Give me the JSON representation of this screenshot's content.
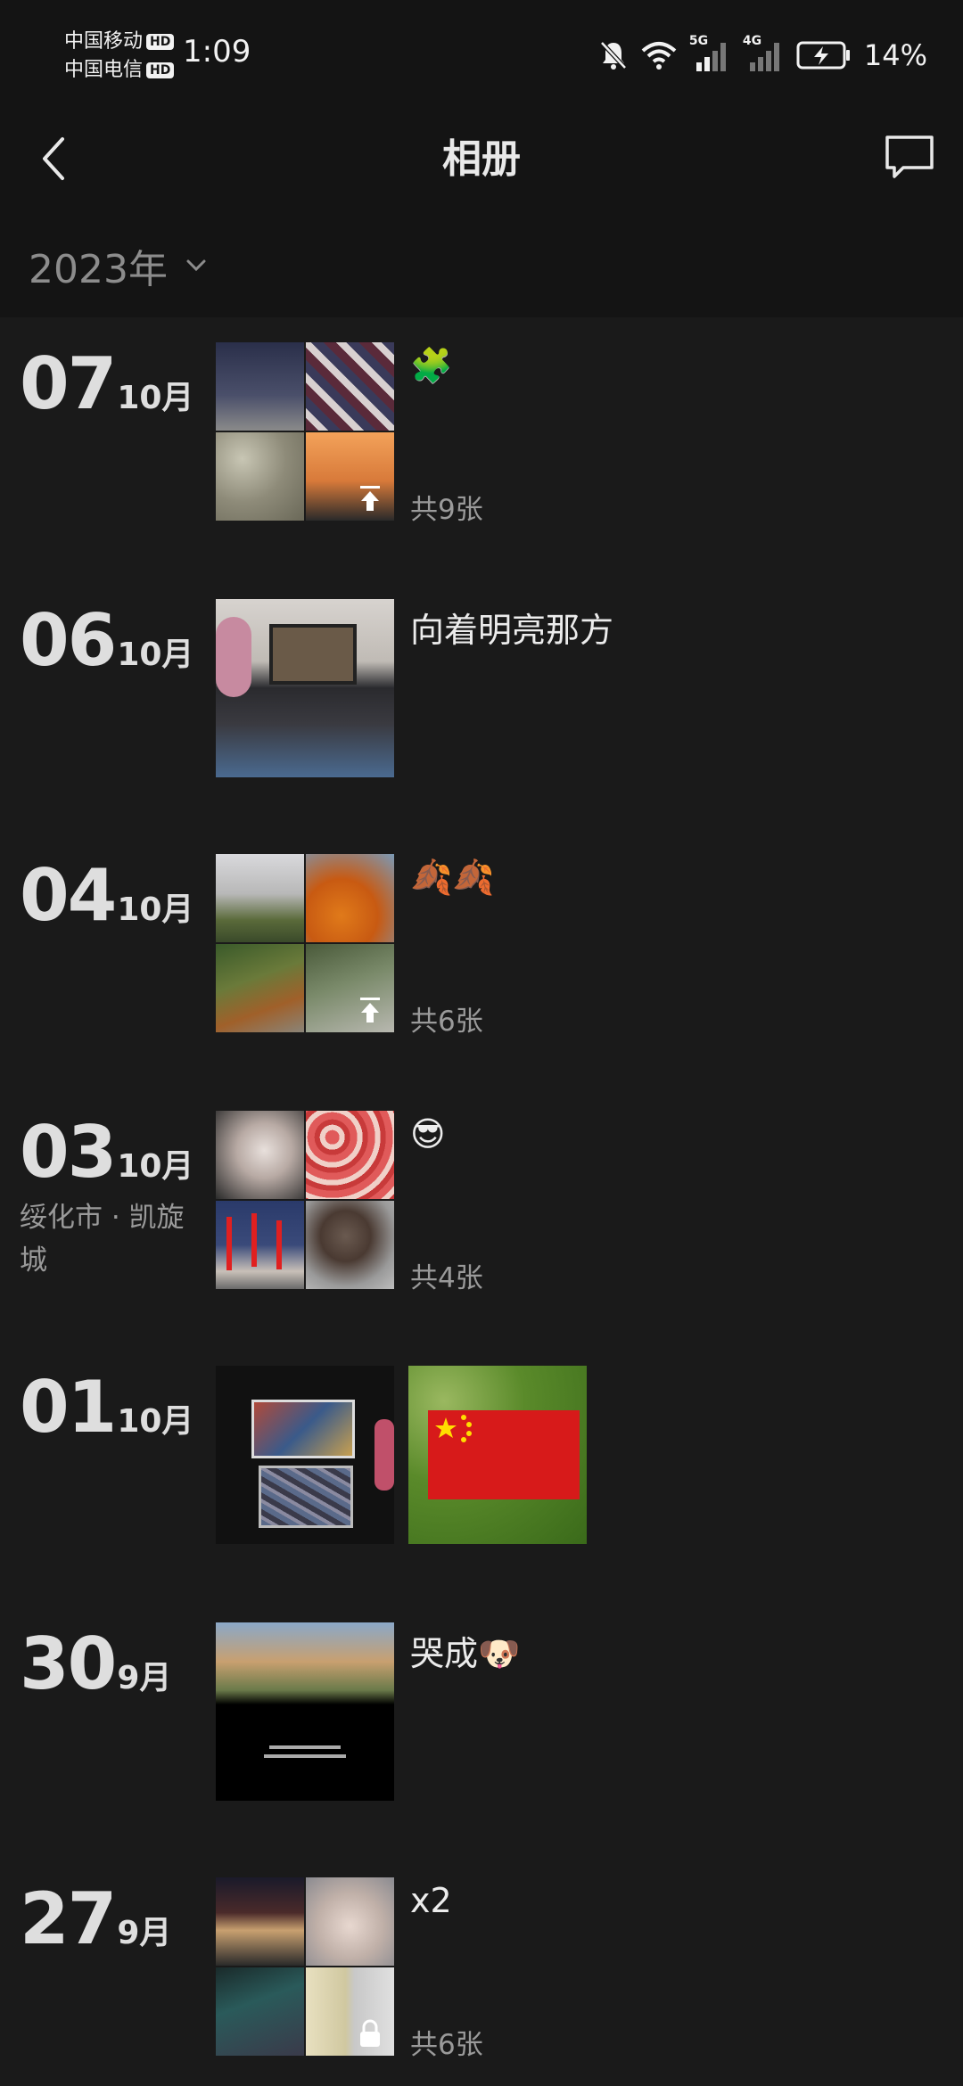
{
  "status_bar": {
    "carrier1": "中国移动",
    "carrier2": "中国电信",
    "hd_badge": "HD",
    "time": "1:09",
    "net1": "5G",
    "net2": "4G",
    "battery": "14%"
  },
  "header": {
    "title": "相册",
    "back_icon": "chevron-left-icon",
    "message_icon": "chat-bubble-icon"
  },
  "year_selector": {
    "label": "2023年",
    "icon": "chevron-down-icon"
  },
  "entries": [
    {
      "day": "07",
      "month": "10月",
      "caption": "🧩",
      "count": "共9张",
      "location": "",
      "photo_count": 4,
      "overlay_icon": "upload-icon"
    },
    {
      "day": "06",
      "month": "10月",
      "caption": "向着明亮那方",
      "count": "",
      "location": "",
      "photo_count": 1,
      "overlay_icon": ""
    },
    {
      "day": "04",
      "month": "10月",
      "caption": "🍂🍂",
      "count": "共6张",
      "location": "",
      "photo_count": 4,
      "overlay_icon": "upload-icon"
    },
    {
      "day": "03",
      "month": "10月",
      "caption": "😎",
      "count": "共4张",
      "location": "绥化市 · 凯旋城",
      "photo_count": 4,
      "overlay_icon": ""
    },
    {
      "day": "01",
      "month": "10月",
      "caption": "",
      "count": "",
      "location": "",
      "photo_count": 2,
      "overlay_icon": ""
    },
    {
      "day": "30",
      "month": "9月",
      "caption": "哭成🐶",
      "count": "",
      "location": "",
      "photo_count": 1,
      "overlay_icon": ""
    },
    {
      "day": "27",
      "month": "9月",
      "caption": "x2",
      "count": "共6张",
      "location": "",
      "photo_count": 4,
      "overlay_icon": "lock-icon"
    }
  ],
  "colors": {
    "background": "#1a1a1a",
    "bar": "#141414",
    "text": "#e8e8e8",
    "muted": "#9a9a9a"
  }
}
